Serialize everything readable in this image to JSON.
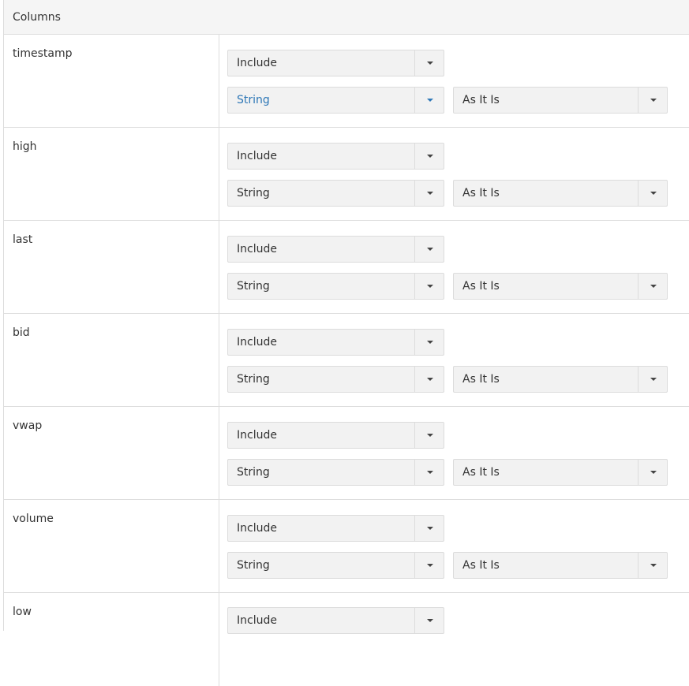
{
  "header": {
    "title": "Columns"
  },
  "columns": [
    {
      "name": "timestamp",
      "include": "Include",
      "type": "String",
      "format": "As It Is"
    },
    {
      "name": "high",
      "include": "Include",
      "type": "String",
      "format": "As It Is"
    },
    {
      "name": "last",
      "include": "Include",
      "type": "String",
      "format": "As It Is"
    },
    {
      "name": "bid",
      "include": "Include",
      "type": "String",
      "format": "As It Is"
    },
    {
      "name": "vwap",
      "include": "Include",
      "type": "String",
      "format": "As It Is"
    },
    {
      "name": "volume",
      "include": "Include",
      "type": "String",
      "format": "As It Is"
    },
    {
      "name": "low",
      "include": "Include"
    }
  ],
  "colors": {
    "active_select": "#2f78b7",
    "panel_header_bg": "#f5f5f5",
    "select_bg": "#f2f2f2"
  }
}
